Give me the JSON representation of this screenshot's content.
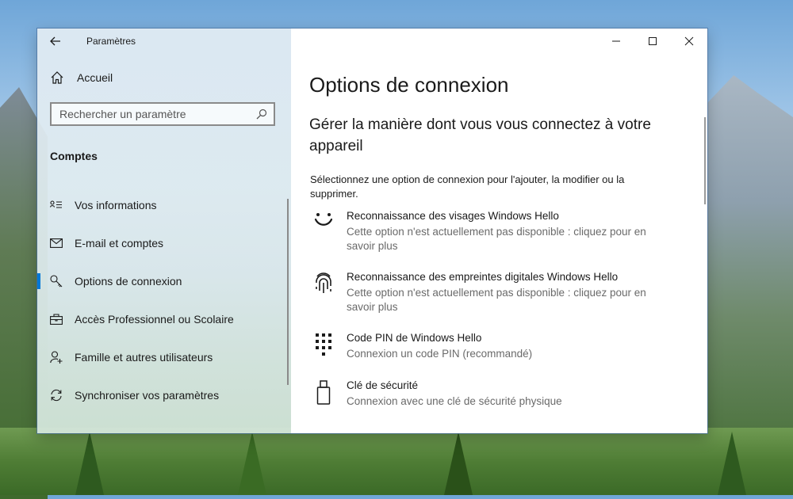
{
  "window": {
    "app_title": "Paramètres"
  },
  "sidebar": {
    "home_label": "Accueil",
    "search_placeholder": "Rechercher un paramètre",
    "section_title": "Comptes",
    "items": [
      {
        "label": "Vos informations",
        "icon": "person-card-icon",
        "active": false
      },
      {
        "label": "E-mail et comptes",
        "icon": "mail-icon",
        "active": false
      },
      {
        "label": "Options de connexion",
        "icon": "key-icon",
        "active": true
      },
      {
        "label": "Accès Professionnel ou Scolaire",
        "icon": "briefcase-icon",
        "active": false
      },
      {
        "label": "Famille et autres utilisateurs",
        "icon": "add-person-icon",
        "active": false
      },
      {
        "label": "Synchroniser vos paramètres",
        "icon": "sync-icon",
        "active": false
      }
    ]
  },
  "main": {
    "page_title": "Options de connexion",
    "subtitle": "Gérer la manière dont vous vous connectez à votre appareil",
    "intro": "Sélectionnez une option de connexion pour l'ajouter, la modifier ou la supprimer.",
    "options": [
      {
        "title": "Reconnaissance des visages Windows Hello",
        "description": "Cette option n'est actuellement pas disponible : cliquez pour en savoir plus",
        "icon": "smiley-face-icon"
      },
      {
        "title": "Reconnaissance des empreintes digitales Windows Hello",
        "description": "Cette option n'est actuellement pas disponible : cliquez pour en savoir plus",
        "icon": "fingerprint-icon"
      },
      {
        "title": "Code PIN de Windows Hello",
        "description": "Connexion un code PIN (recommandé)",
        "icon": "pin-keypad-icon"
      },
      {
        "title": "Clé de sécurité",
        "description": "Connexion avec une clé de sécurité physique",
        "icon": "usb-key-icon"
      }
    ]
  },
  "colors": {
    "accent": "#0078d7"
  }
}
